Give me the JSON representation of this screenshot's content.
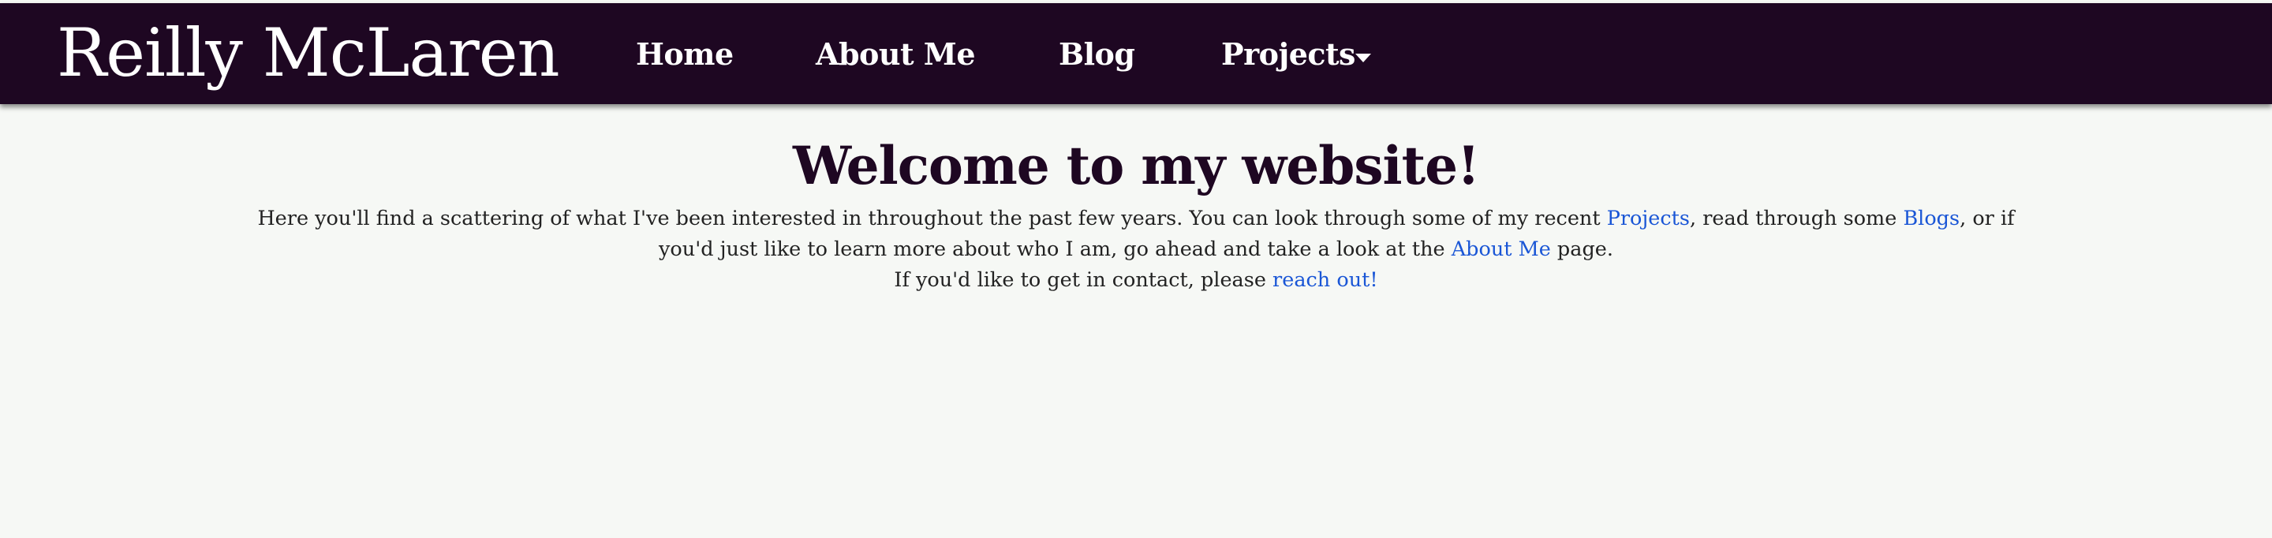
{
  "navbar": {
    "brand": "Reilly McLaren",
    "links": {
      "home": "Home",
      "about": "About Me",
      "blog": "Blog",
      "projects": "Projects"
    }
  },
  "main": {
    "heading": "Welcome to my website!",
    "intro": {
      "part1": "Here you'll find a scattering of what I've been interested in throughout the past few years. You can look through some of my recent ",
      "projects_link": "Projects",
      "part2": ", read through some ",
      "blogs_link": "Blogs",
      "part3": ", or if you'd just like to learn more about who I am, go ahead and take a look at the ",
      "about_link": "About Me",
      "part4": " page.",
      "contact_text": "If you'd like to get in contact, please ",
      "contact_link": "reach out!"
    }
  },
  "colors": {
    "navbar_bg": "#1e0722",
    "page_bg": "#f6f8f5",
    "heading": "#1e0722",
    "link": "#1a56d6"
  },
  "icons": {
    "projects_dropdown": "caret-down-icon"
  }
}
